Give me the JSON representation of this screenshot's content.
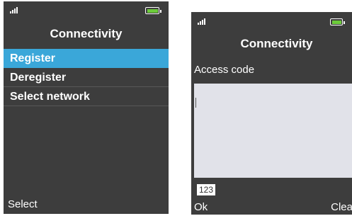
{
  "screen1": {
    "title": "Connectivity",
    "menu": [
      {
        "label": "Register",
        "selected": true
      },
      {
        "label": "Deregister",
        "selected": false
      },
      {
        "label": "Select network",
        "selected": false
      }
    ],
    "softkey_left": "Select",
    "battery_color": "#6ccb3a",
    "highlight_color": "#3aa7d9",
    "icons": [
      "signal-strength-icon",
      "battery-icon"
    ]
  },
  "screen2": {
    "title": "Connectivity",
    "field_label": "Access code",
    "input_value": "",
    "input_mode": "123",
    "softkey_left": "Ok",
    "softkey_right": "Clear",
    "battery_color": "#6ccb3a",
    "icons": [
      "signal-strength-icon",
      "battery-icon"
    ]
  }
}
